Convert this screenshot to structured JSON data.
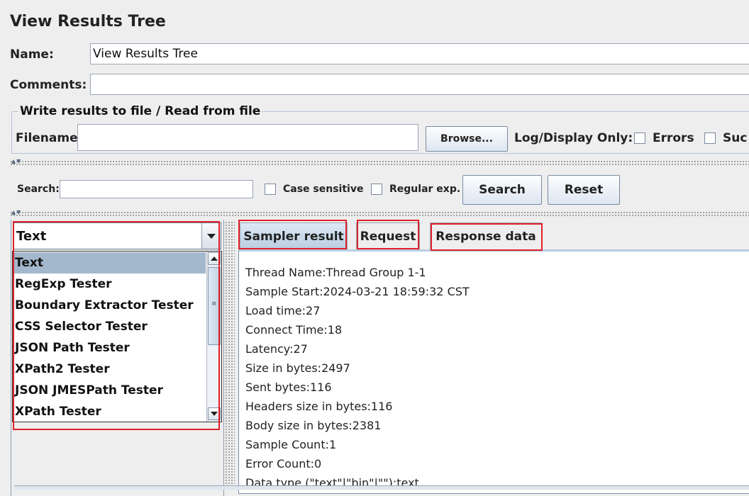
{
  "panel": {
    "title": "View Results Tree"
  },
  "name_field": {
    "label": "Name:",
    "value": "View Results Tree"
  },
  "comments_field": {
    "label": "Comments:",
    "value": ""
  },
  "file_group": {
    "title": "Write results to file / Read from file",
    "filename_label": "Filename",
    "filename_value": "",
    "browse_label": "Browse...",
    "log_display_label": "Log/Display Only:",
    "errors_label": "Errors",
    "successes_label": "Suc"
  },
  "search": {
    "label": "Search:",
    "value": "",
    "case_sensitive_label": "Case sensitive",
    "regular_exp_label": "Regular exp.",
    "search_button": "Search",
    "reset_button": "Reset"
  },
  "renderer": {
    "selected": "Text",
    "options": [
      "Text",
      "RegExp Tester",
      "Boundary Extractor Tester",
      "CSS Selector Tester",
      "JSON Path Tester",
      "XPath2 Tester",
      "JSON JMESPath Tester",
      "XPath Tester"
    ]
  },
  "tabs": [
    {
      "label": "Sampler result",
      "active": true
    },
    {
      "label": "Request",
      "active": false
    },
    {
      "label": "Response data",
      "active": false
    }
  ],
  "sampler_result": {
    "lines": [
      "Thread Name:Thread Group 1-1",
      "Sample Start:2024-03-21 18:59:32 CST",
      "Load time:27",
      "Connect Time:18",
      "Latency:27",
      "Size in bytes:2497",
      "Sent bytes:116",
      "Headers size in bytes:116",
      "Body size in bytes:2381",
      "Sample Count:1",
      "Error Count:0",
      "Data type (\"text\"|\"bin\"|\"\"):text"
    ]
  },
  "colors": {
    "highlight_red": "#e0202a",
    "selected_row": "#a3b8cc",
    "active_tab": "#b8cde3"
  }
}
